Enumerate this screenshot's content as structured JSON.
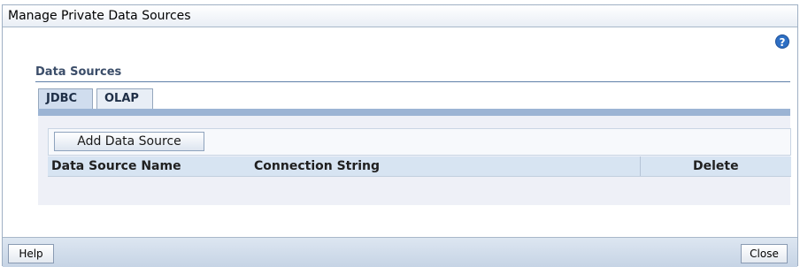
{
  "dialog": {
    "title": "Manage Private Data Sources",
    "help_icon_glyph": "?"
  },
  "section": {
    "title": "Data Sources"
  },
  "tabs": [
    {
      "label": "JDBC",
      "selected": true
    },
    {
      "label": "OLAP",
      "selected": false
    }
  ],
  "toolbar": {
    "add_label": "Add Data Source"
  },
  "table": {
    "columns": [
      "Data Source Name",
      "Connection String",
      "Delete"
    ],
    "rows": []
  },
  "footer": {
    "help_label": "Help",
    "close_label": "Close"
  },
  "colors": {
    "accent": "#2e6fc4",
    "tab_band": "#9cb4d4",
    "section_title": "#3b4d69"
  }
}
